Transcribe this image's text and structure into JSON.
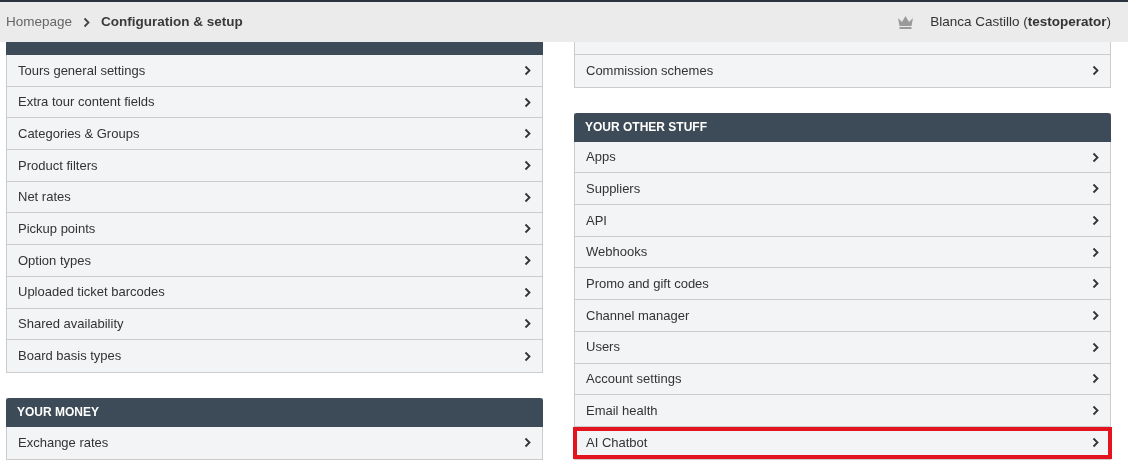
{
  "breadcrumb": [
    {
      "label": "Homepage",
      "current": false
    },
    {
      "label": "Configuration & setup",
      "current": true
    }
  ],
  "user": {
    "text": "Blanca Castillo (**testoperator**)"
  },
  "columns": [
    {
      "sections": [
        {
          "kind": "clipped-header",
          "items": [
            {
              "label": "Tours general settings",
              "highlighted": false
            },
            {
              "label": "Extra tour content fields",
              "highlighted": false
            },
            {
              "label": "Categories & Groups",
              "highlighted": false
            },
            {
              "label": "Product filters",
              "highlighted": false
            },
            {
              "label": "Net rates",
              "highlighted": false
            },
            {
              "label": "Pickup points",
              "highlighted": false
            },
            {
              "label": "Option types",
              "highlighted": false
            },
            {
              "label": "Uploaded ticket barcodes",
              "highlighted": false
            },
            {
              "label": "Shared availability",
              "highlighted": false
            },
            {
              "label": "Board basis types",
              "highlighted": false
            }
          ]
        },
        {
          "kind": "titled",
          "title": "YOUR MONEY",
          "items": [
            {
              "label": "Exchange rates",
              "highlighted": false
            }
          ]
        }
      ]
    },
    {
      "sections": [
        {
          "kind": "continued",
          "items": [
            {
              "label": "Commission schemes",
              "highlighted": false
            }
          ]
        },
        {
          "kind": "titled",
          "title": "YOUR OTHER STUFF",
          "items": [
            {
              "label": "Apps",
              "highlighted": false
            },
            {
              "label": "Suppliers",
              "highlighted": false
            },
            {
              "label": "API",
              "highlighted": false
            },
            {
              "label": "Webhooks",
              "highlighted": false
            },
            {
              "label": "Promo and gift codes",
              "highlighted": false
            },
            {
              "label": "Channel manager",
              "highlighted": false
            },
            {
              "label": "Users",
              "highlighted": false
            },
            {
              "label": "Account settings",
              "highlighted": false
            },
            {
              "label": "Email health",
              "highlighted": false
            },
            {
              "label": "AI Chatbot",
              "highlighted": true
            }
          ]
        }
      ]
    }
  ]
}
